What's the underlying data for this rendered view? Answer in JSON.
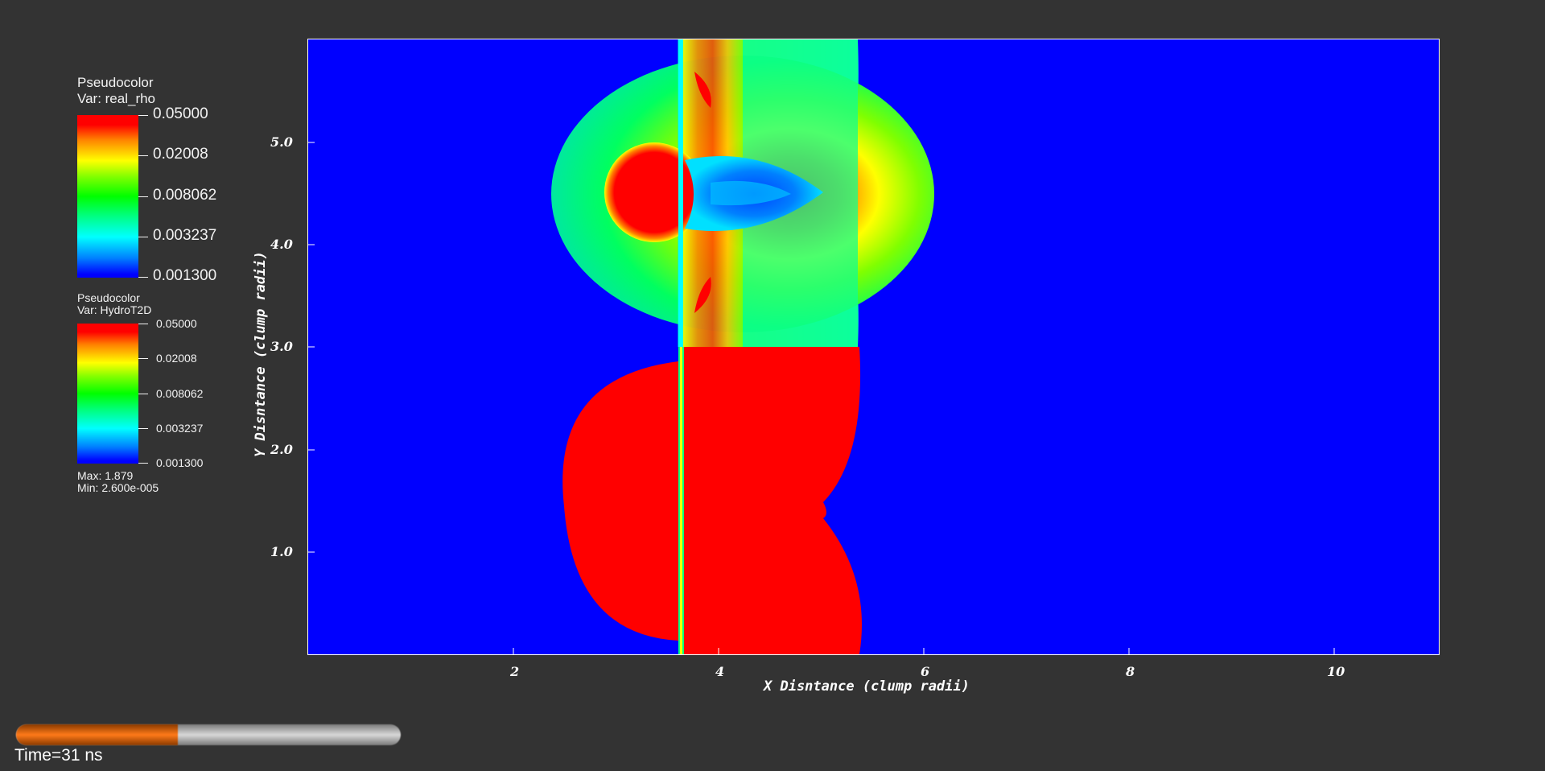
{
  "legend_rho": {
    "title": "Pseudocolor",
    "var": "Var: real_rho",
    "labels": [
      "0.05000",
      "0.02008",
      "0.008062",
      "0.003237",
      "0.001300"
    ]
  },
  "legend_temp": {
    "title": "Pseudocolor",
    "var": "Var: HydroT2D",
    "labels": [
      "0.05000",
      "0.02008",
      "0.008062",
      "0.003237",
      "0.001300"
    ],
    "max": "Max:  1.879",
    "min": "Min:  2.600e-005"
  },
  "axes": {
    "x_title": "X Disntance (clump radii)",
    "y_title": "Y Disntance (clump radii)",
    "x_ticks": [
      "2",
      "4",
      "6",
      "8",
      "10"
    ],
    "y_ticks": [
      "1.0",
      "2.0",
      "3.0",
      "4.0",
      "5.0"
    ]
  },
  "time": {
    "label": "Time=31 ns",
    "progress": 0.42
  },
  "colors": {
    "background": "#333333",
    "plot_background": "#0000ff",
    "slider_fill": "#ff7a1a"
  }
}
